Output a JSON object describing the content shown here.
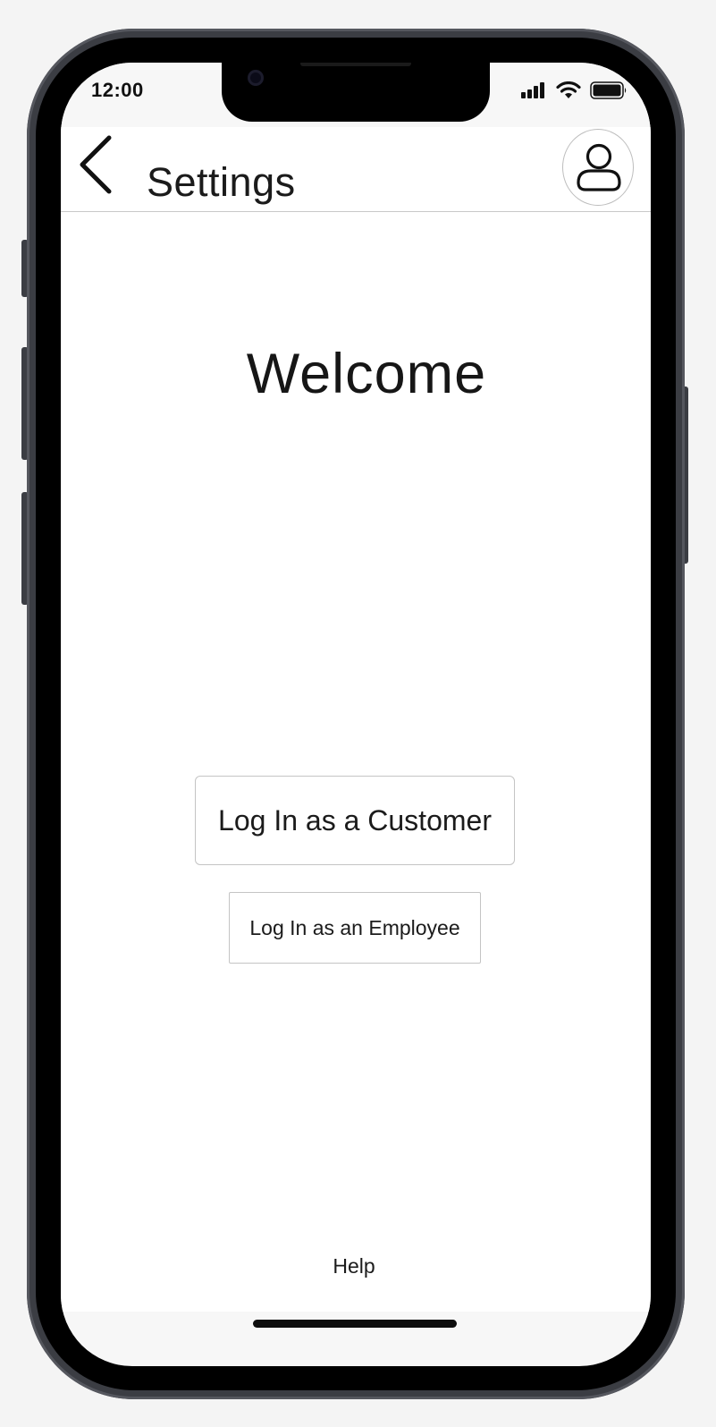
{
  "status_bar": {
    "time": "12:00",
    "icons": [
      "signal-icon",
      "wifi-icon",
      "battery-icon"
    ]
  },
  "header": {
    "back_icon": "chevron-left-icon",
    "title": "Settings",
    "profile_icon": "user-icon"
  },
  "main": {
    "welcome": "Welcome",
    "customer_login_label": "Log In as a Customer",
    "employee_login_label": "Log In as an Employee"
  },
  "footer": {
    "help_label": "Help"
  },
  "colors": {
    "text": "#1b1b1b",
    "border": "#c4c4c4",
    "frame": "#3b3d43",
    "background": "#ffffff"
  }
}
